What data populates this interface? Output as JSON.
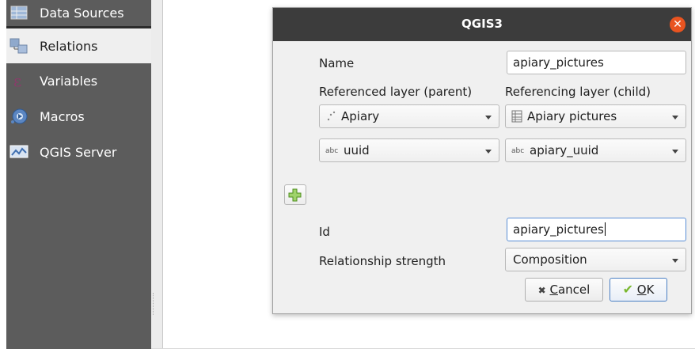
{
  "sidebar": {
    "items": [
      {
        "label": "Data Sources",
        "icon": "table-icon"
      },
      {
        "label": "Relations",
        "icon": "relations-icon"
      },
      {
        "label": "Variables",
        "icon": "epsilon-icon"
      },
      {
        "label": "Macros",
        "icon": "gear-icon"
      },
      {
        "label": "QGIS Server",
        "icon": "server-icon"
      }
    ]
  },
  "dialog": {
    "title": "QGIS3",
    "name_label": "Name",
    "name_value": "apiary_pictures",
    "parent_label": "Referenced layer (parent)",
    "child_label": "Referencing layer (child)",
    "parent_layer": "Apiary",
    "child_layer": "Apiary pictures",
    "parent_field_type": "abc",
    "parent_field": "uuid",
    "child_field_type": "abc",
    "child_field": "apiary_uuid",
    "id_label": "Id",
    "id_value": "apiary_pictures",
    "strength_label": "Relationship strength",
    "strength_value": "Composition",
    "cancel_icon_glyph": "✖",
    "cancel_prefix": "",
    "cancel_mnemonic": "C",
    "cancel_rest": "ancel",
    "ok_icon_glyph": "✔",
    "ok_mnemonic": "O",
    "ok_rest": "K"
  },
  "colors": {
    "titlebar": "#3c3c3c",
    "close": "#e95420",
    "sidebar": "#5c5c5c"
  }
}
